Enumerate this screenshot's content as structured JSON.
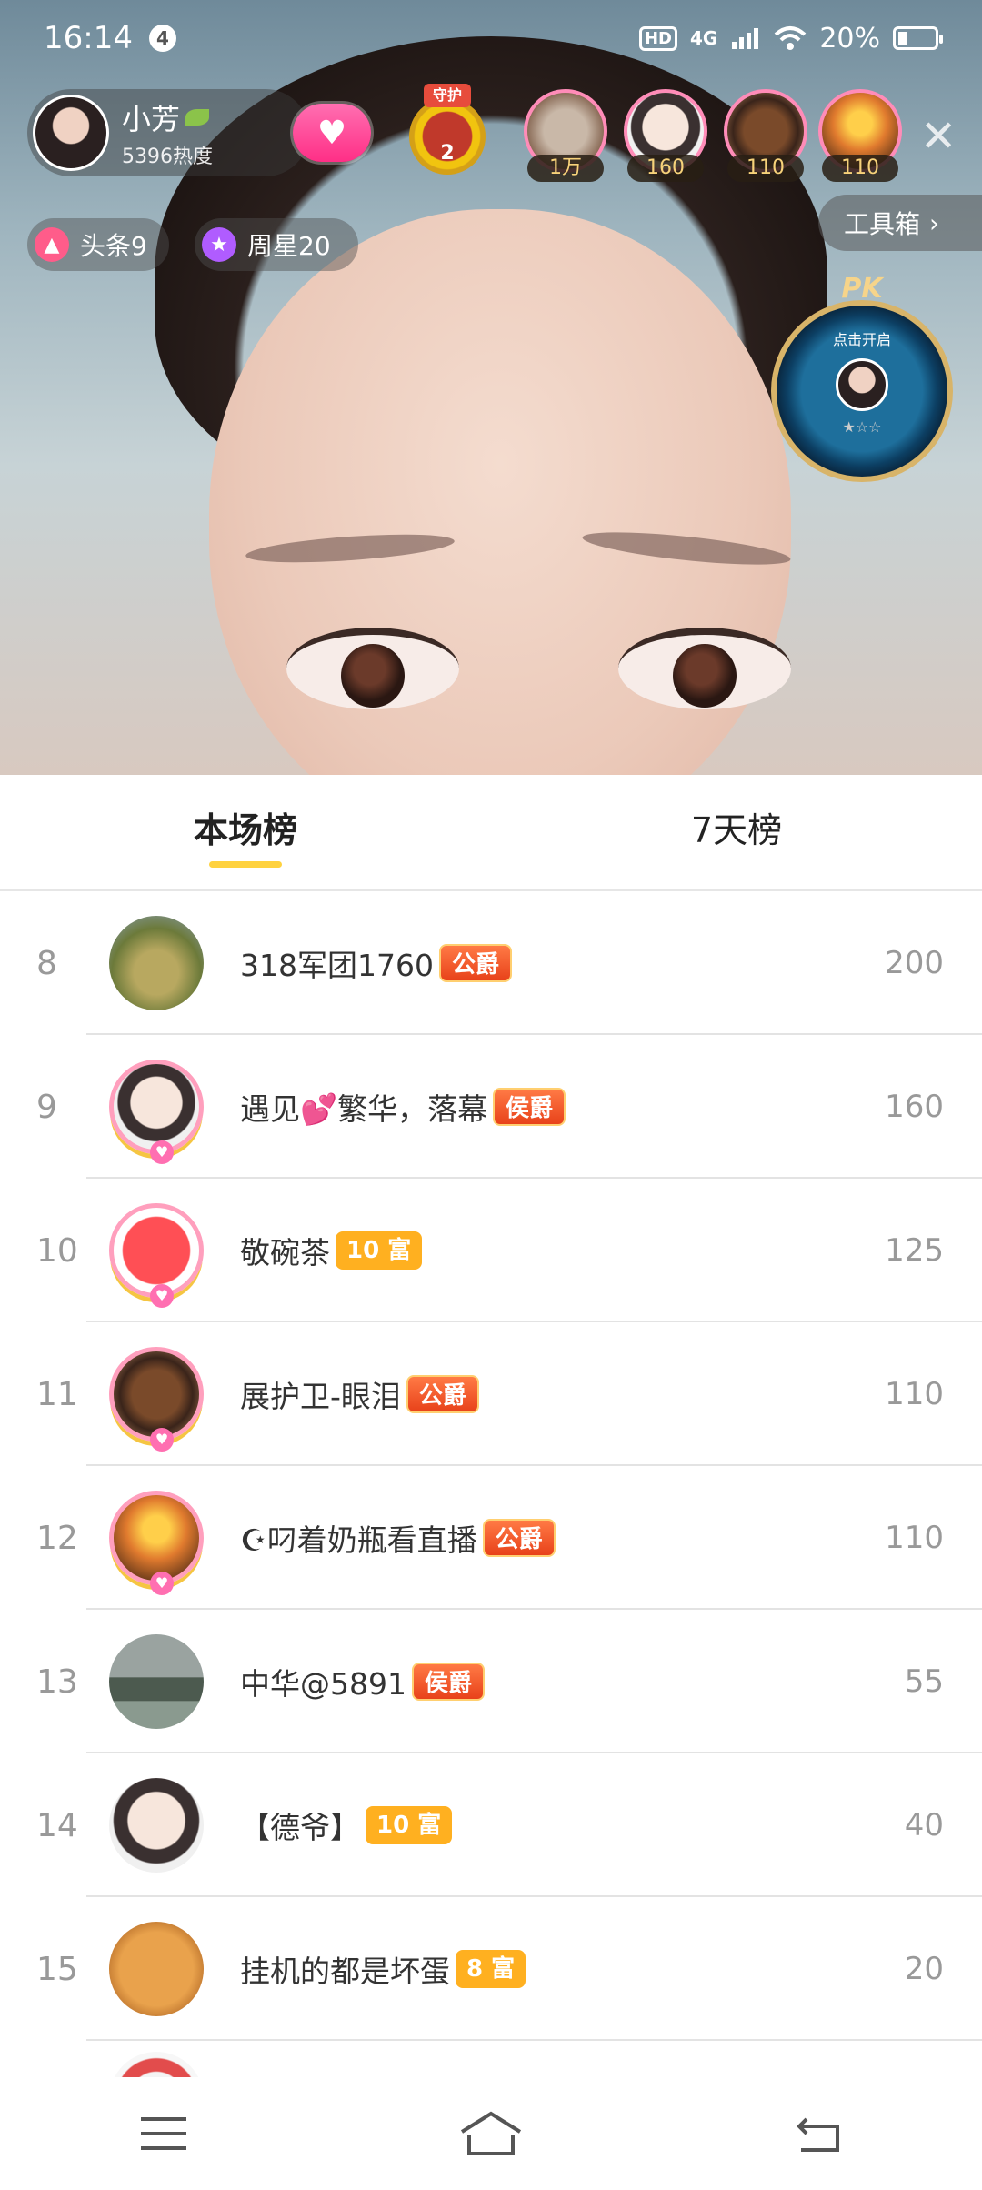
{
  "status_bar": {
    "time": "16:14",
    "notification_count": "4",
    "hd": "HD",
    "network": "4G",
    "battery": "20%"
  },
  "host": {
    "name": "小芳",
    "heat": "5396热度"
  },
  "guard": {
    "tag": "守护",
    "count": "2"
  },
  "top_viewers": [
    {
      "count": "1万"
    },
    {
      "count": "160"
    },
    {
      "count": "110"
    },
    {
      "count": "110"
    }
  ],
  "chips": {
    "headline": "头条9",
    "weekly_star": "周星20"
  },
  "toolbox": {
    "label": "工具箱"
  },
  "pk": {
    "label": "PK",
    "text": "点击开启",
    "stars": "★☆☆"
  },
  "tabs": [
    {
      "label": "本场榜",
      "active": true
    },
    {
      "label": "7天榜",
      "active": false
    }
  ],
  "ranking": [
    {
      "rank": "8",
      "name": "318军团1760",
      "badge": "公爵",
      "badge_type": "noble",
      "score": "200"
    },
    {
      "rank": "9",
      "name": "遇见💕繁华，落幕",
      "badge": "侯爵",
      "badge_type": "noble",
      "score": "160"
    },
    {
      "rank": "10",
      "name": "敬碗茶",
      "badge": "10 富",
      "badge_type": "rich",
      "score": "125"
    },
    {
      "rank": "11",
      "name": "展护卫-眼泪",
      "badge": "公爵",
      "badge_type": "noble",
      "score": "110"
    },
    {
      "rank": "12",
      "name": "☪叼着奶瓶看直播",
      "badge": "公爵",
      "badge_type": "noble",
      "score": "110"
    },
    {
      "rank": "13",
      "name": "中华@5891",
      "badge": "侯爵",
      "badge_type": "noble",
      "score": "55"
    },
    {
      "rank": "14",
      "name": "【德爷】",
      "badge": "10 富",
      "badge_type": "rich",
      "score": "40"
    },
    {
      "rank": "15",
      "name": "挂机的都是坏蛋",
      "badge": "8 富",
      "badge_type": "rich",
      "score": "20"
    }
  ],
  "icons": {
    "close": "close-icon",
    "menu": "menu-icon",
    "home": "home-icon",
    "back": "back-icon"
  },
  "colors": {
    "accent_yellow": "#ffd23f",
    "noble_badge": "#e8421a",
    "rich_badge": "#ffb020",
    "follow_pink": "#ff2f86"
  }
}
